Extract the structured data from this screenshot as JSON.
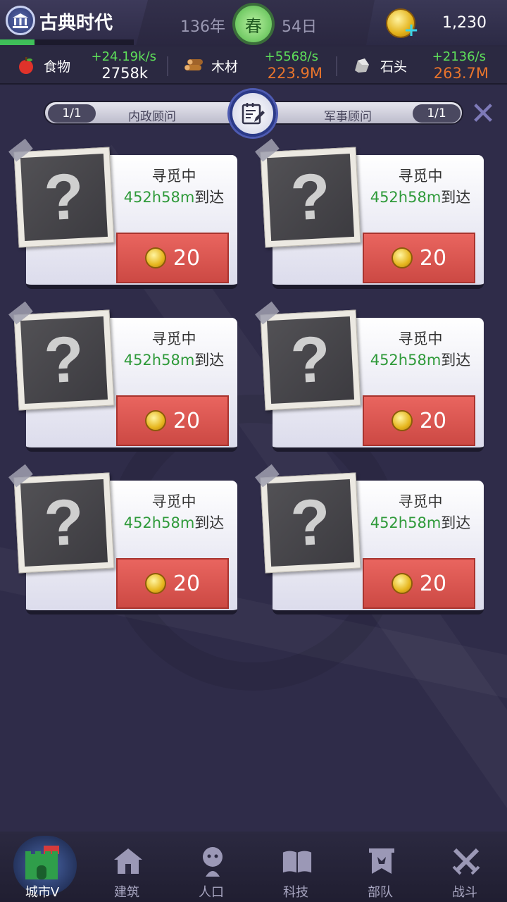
{
  "header": {
    "era_title": "古典时代",
    "year": "136年",
    "season": "春",
    "day": "54日",
    "coins": "1,230",
    "era_progress": 0.26
  },
  "resources": [
    {
      "name": "食物",
      "rate": "+24.19k/s",
      "amount": "2758k",
      "amount_color": "#ffffff",
      "icon": "apple-icon"
    },
    {
      "name": "木材",
      "rate": "+5568/s",
      "amount": "223.9M",
      "amount_color": "#e8742c",
      "icon": "wood-icon"
    },
    {
      "name": "石头",
      "rate": "+2136/s",
      "amount": "263.7M",
      "amount_color": "#e8742c",
      "icon": "stone-icon"
    }
  ],
  "advisor": {
    "left_count": "1/1",
    "left_label": "内政顾问",
    "right_label": "军事顾问",
    "right_count": "1/1"
  },
  "cards": [
    {
      "photo": "?",
      "status": "寻觅中",
      "eta_time": "452h58m",
      "eta_suffix": "到达",
      "cost": "20"
    },
    {
      "photo": "?",
      "status": "寻觅中",
      "eta_time": "452h58m",
      "eta_suffix": "到达",
      "cost": "20"
    },
    {
      "photo": "?",
      "status": "寻觅中",
      "eta_time": "452h58m",
      "eta_suffix": "到达",
      "cost": "20"
    },
    {
      "photo": "?",
      "status": "寻觅中",
      "eta_time": "452h58m",
      "eta_suffix": "到达",
      "cost": "20"
    },
    {
      "photo": "?",
      "status": "寻觅中",
      "eta_time": "452h58m",
      "eta_suffix": "到达",
      "cost": "20"
    },
    {
      "photo": "?",
      "status": "寻觅中",
      "eta_time": "452h58m",
      "eta_suffix": "到达",
      "cost": "20"
    }
  ],
  "nav": [
    {
      "label": "城市Ⅴ",
      "icon": "city-castle-icon",
      "active": true
    },
    {
      "label": "建筑",
      "icon": "house-icon",
      "active": false
    },
    {
      "label": "人口",
      "icon": "person-icon",
      "active": false
    },
    {
      "label": "科技",
      "icon": "book-icon",
      "active": false
    },
    {
      "label": "部队",
      "icon": "banner-icon",
      "active": false
    },
    {
      "label": "战斗",
      "icon": "crossed-swords-icon",
      "active": false
    }
  ],
  "colors": {
    "background": "#2f2c49",
    "green_rate": "#5ee05a",
    "orange_amount": "#e8742c",
    "eta_green": "#2f9a3a",
    "speed_button": "#d9544f"
  }
}
